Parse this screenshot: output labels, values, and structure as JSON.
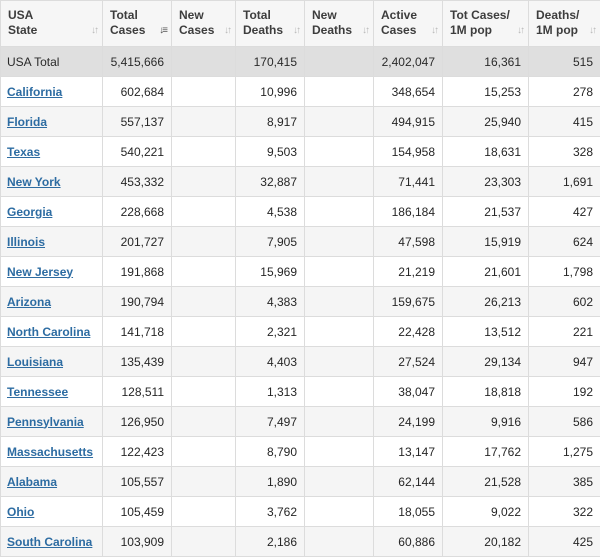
{
  "columns": [
    {
      "l1": "USA",
      "l2": "State",
      "sort_icon": "sort-icon",
      "active": false
    },
    {
      "l1": "Total",
      "l2": "Cases",
      "sort_icon": "sort-desc-icon",
      "active": true
    },
    {
      "l1": "New",
      "l2": "Cases",
      "sort_icon": "sort-icon",
      "active": false
    },
    {
      "l1": "Total",
      "l2": "Deaths",
      "sort_icon": "sort-icon",
      "active": false
    },
    {
      "l1": "New",
      "l2": "Deaths",
      "sort_icon": "sort-icon",
      "active": false
    },
    {
      "l1": "Active",
      "l2": "Cases",
      "sort_icon": "sort-icon",
      "active": false
    },
    {
      "l1": "Tot Cases/",
      "l2": "1M pop",
      "sort_icon": "sort-icon",
      "active": false
    },
    {
      "l1": "Deaths/",
      "l2": "1M pop",
      "sort_icon": "sort-icon",
      "active": false
    }
  ],
  "total": {
    "state": "USA Total",
    "total_cases": "5,415,666",
    "new_cases": "",
    "total_deaths": "170,415",
    "new_deaths": "",
    "active_cases": "2,402,047",
    "cases_per_1m": "16,361",
    "deaths_per_1m": "515"
  },
  "rows": [
    {
      "state": "California",
      "total_cases": "602,684",
      "new_cases": "",
      "total_deaths": "10,996",
      "new_deaths": "",
      "active_cases": "348,654",
      "cases_per_1m": "15,253",
      "deaths_per_1m": "278"
    },
    {
      "state": "Florida",
      "total_cases": "557,137",
      "new_cases": "",
      "total_deaths": "8,917",
      "new_deaths": "",
      "active_cases": "494,915",
      "cases_per_1m": "25,940",
      "deaths_per_1m": "415"
    },
    {
      "state": "Texas",
      "total_cases": "540,221",
      "new_cases": "",
      "total_deaths": "9,503",
      "new_deaths": "",
      "active_cases": "154,958",
      "cases_per_1m": "18,631",
      "deaths_per_1m": "328"
    },
    {
      "state": "New York",
      "total_cases": "453,332",
      "new_cases": "",
      "total_deaths": "32,887",
      "new_deaths": "",
      "active_cases": "71,441",
      "cases_per_1m": "23,303",
      "deaths_per_1m": "1,691"
    },
    {
      "state": "Georgia",
      "total_cases": "228,668",
      "new_cases": "",
      "total_deaths": "4,538",
      "new_deaths": "",
      "active_cases": "186,184",
      "cases_per_1m": "21,537",
      "deaths_per_1m": "427"
    },
    {
      "state": "Illinois",
      "total_cases": "201,727",
      "new_cases": "",
      "total_deaths": "7,905",
      "new_deaths": "",
      "active_cases": "47,598",
      "cases_per_1m": "15,919",
      "deaths_per_1m": "624"
    },
    {
      "state": "New Jersey",
      "total_cases": "191,868",
      "new_cases": "",
      "total_deaths": "15,969",
      "new_deaths": "",
      "active_cases": "21,219",
      "cases_per_1m": "21,601",
      "deaths_per_1m": "1,798"
    },
    {
      "state": "Arizona",
      "total_cases": "190,794",
      "new_cases": "",
      "total_deaths": "4,383",
      "new_deaths": "",
      "active_cases": "159,675",
      "cases_per_1m": "26,213",
      "deaths_per_1m": "602"
    },
    {
      "state": "North Carolina",
      "total_cases": "141,718",
      "new_cases": "",
      "total_deaths": "2,321",
      "new_deaths": "",
      "active_cases": "22,428",
      "cases_per_1m": "13,512",
      "deaths_per_1m": "221"
    },
    {
      "state": "Louisiana",
      "total_cases": "135,439",
      "new_cases": "",
      "total_deaths": "4,403",
      "new_deaths": "",
      "active_cases": "27,524",
      "cases_per_1m": "29,134",
      "deaths_per_1m": "947"
    },
    {
      "state": "Tennessee",
      "total_cases": "128,511",
      "new_cases": "",
      "total_deaths": "1,313",
      "new_deaths": "",
      "active_cases": "38,047",
      "cases_per_1m": "18,818",
      "deaths_per_1m": "192"
    },
    {
      "state": "Pennsylvania",
      "total_cases": "126,950",
      "new_cases": "",
      "total_deaths": "7,497",
      "new_deaths": "",
      "active_cases": "24,199",
      "cases_per_1m": "9,916",
      "deaths_per_1m": "586"
    },
    {
      "state": "Massachusetts",
      "total_cases": "122,423",
      "new_cases": "",
      "total_deaths": "8,790",
      "new_deaths": "",
      "active_cases": "13,147",
      "cases_per_1m": "17,762",
      "deaths_per_1m": "1,275"
    },
    {
      "state": "Alabama",
      "total_cases": "105,557",
      "new_cases": "",
      "total_deaths": "1,890",
      "new_deaths": "",
      "active_cases": "62,144",
      "cases_per_1m": "21,528",
      "deaths_per_1m": "385"
    },
    {
      "state": "Ohio",
      "total_cases": "105,459",
      "new_cases": "",
      "total_deaths": "3,762",
      "new_deaths": "",
      "active_cases": "18,055",
      "cases_per_1m": "9,022",
      "deaths_per_1m": "322"
    },
    {
      "state": "South Carolina",
      "total_cases": "103,909",
      "new_cases": "",
      "total_deaths": "2,186",
      "new_deaths": "",
      "active_cases": "60,886",
      "cases_per_1m": "20,182",
      "deaths_per_1m": "425"
    }
  ],
  "colors": {
    "link": "#2d6ca2",
    "header_bg": "#f6f6f6",
    "total_row_bg": "#dfdfdf",
    "alt_row_bg": "#f5f5f5",
    "border": "#dcdcdc"
  }
}
